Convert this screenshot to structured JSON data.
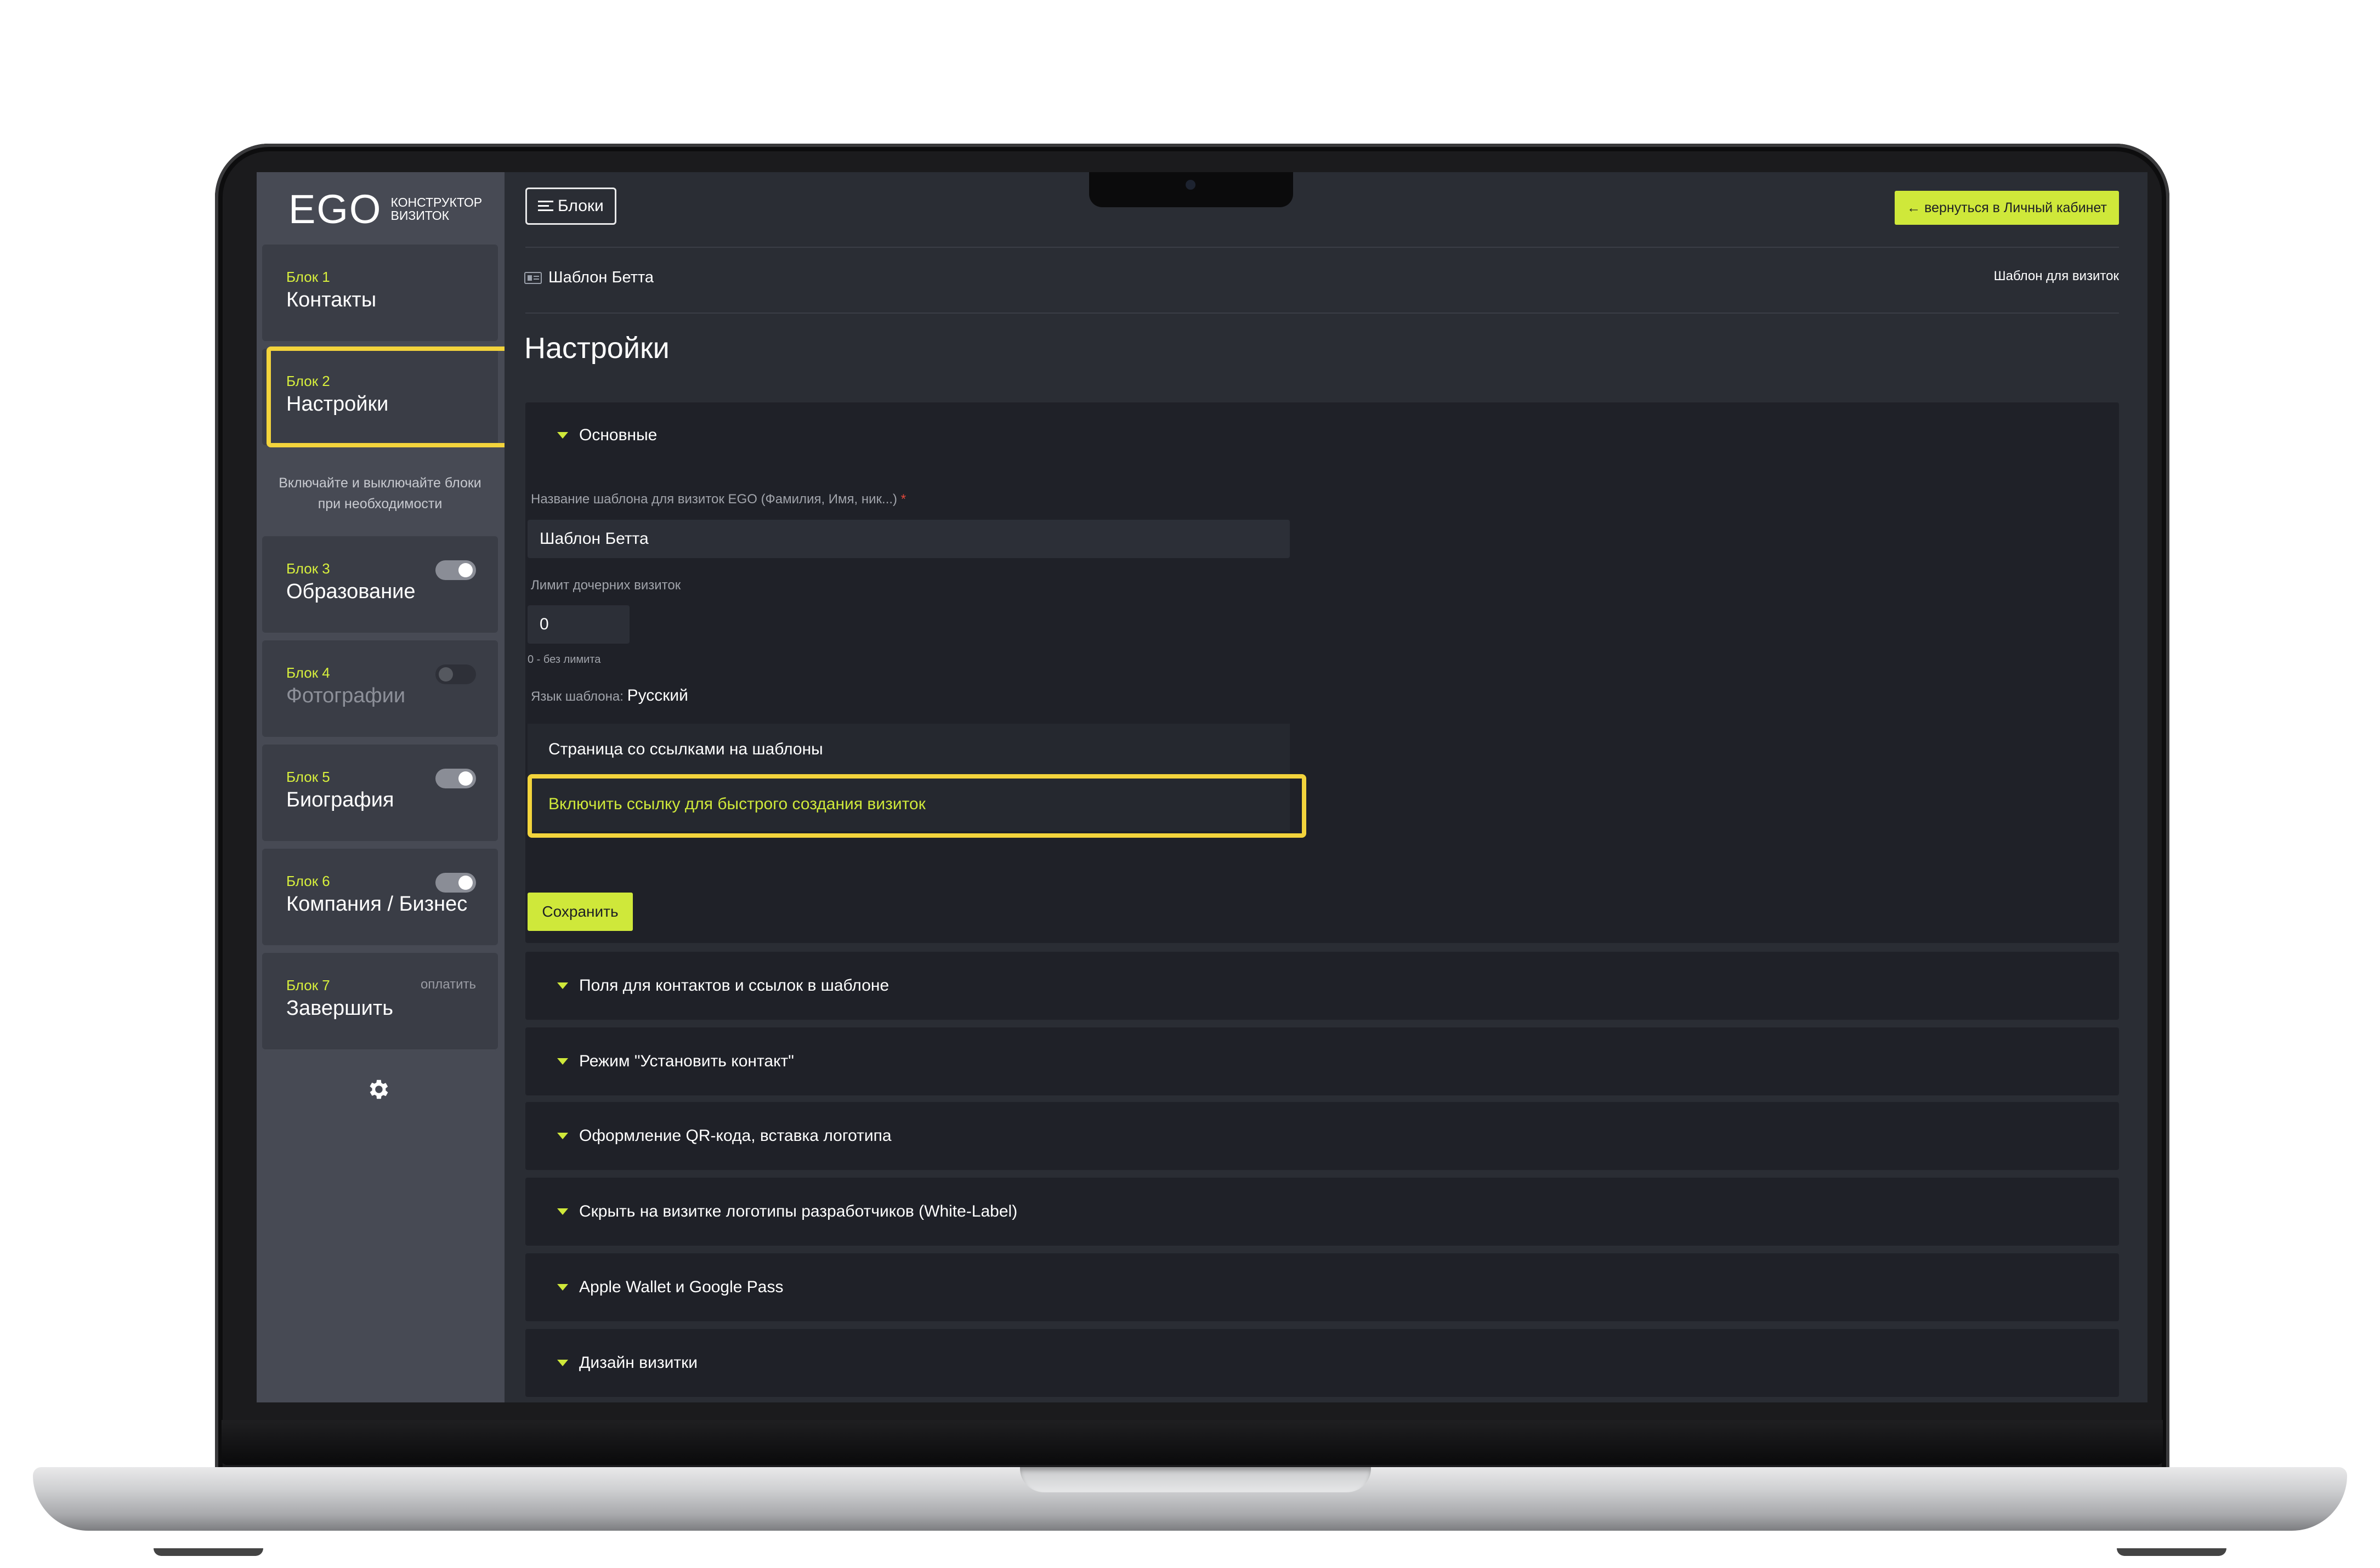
{
  "sidebar": {
    "logo": {
      "brand": "EGO",
      "sub_line1": "конструктор",
      "sub_line2": "визиток"
    },
    "blocks": [
      {
        "num": "Блок 1",
        "title": "Контакты"
      },
      {
        "num": "Блок 2",
        "title": "Настройки"
      },
      {
        "num": "Блок 3",
        "title": "Образование",
        "toggle": "on"
      },
      {
        "num": "Блок 4",
        "title": "Фотографии",
        "toggle": "off"
      },
      {
        "num": "Блок 5",
        "title": "Биография",
        "toggle": "on"
      },
      {
        "num": "Блок 6",
        "title": "Компания / Бизнес",
        "toggle": "on"
      },
      {
        "num": "Блок 7",
        "title": "Завершить",
        "badge": "оплатить"
      }
    ],
    "note_line1": "Включайте и выключайте блоки",
    "note_line2": "при необходимости",
    "settings_icon": "gear-icon"
  },
  "header": {
    "blocks_button": "Блоки",
    "back_button": "← вернуться в Личный кабинет"
  },
  "breadcrumb": {
    "current": "Шаблон Бетта",
    "right": "Шаблон для визиток"
  },
  "page_title": "Настройки",
  "basic_section": {
    "title": "Основные",
    "name_label": "Название шаблона для визиток EGO (Фамилия, Имя, ник...)",
    "name_required": "*",
    "name_value": "Шаблон Бетта",
    "limit_label": "Лимит дочерних визиток",
    "limit_value": "0",
    "limit_hint": "0 - без лимита",
    "lang_label": "Язык шаблона:",
    "lang_value": "Русский",
    "links_page": "Страница со ссылками на шаблоны",
    "quick_link": "Включить ссылку для быстрого создания визиток",
    "save_button": "Сохранить"
  },
  "accordions": [
    "Поля для контактов и ссылок в шаблоне",
    "Режим \"Установить контакт\"",
    "Оформление QR-кода, вставка логотипа",
    "Скрыть на визитке логотипы разработчиков (White-Label)",
    "Apple Wallet и Google Pass",
    "Дизайн визитки"
  ],
  "colors": {
    "accent": "#cfe83a",
    "highlight": "#f3d43c",
    "sidebar_bg": "#474a54",
    "main_bg": "#2a2d34",
    "panel_bg": "#1f2128"
  }
}
